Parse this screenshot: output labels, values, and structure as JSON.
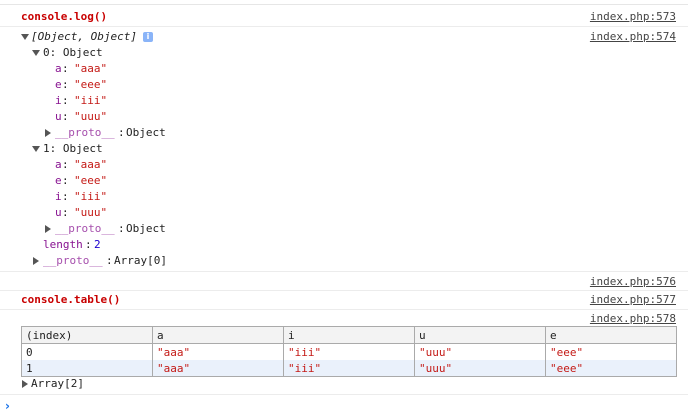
{
  "msg1": {
    "label": "console.log()",
    "source": "index.php:573"
  },
  "array_log": {
    "source": "index.php:574",
    "summary": "[Object, Object]",
    "info_badge": "i",
    "items": [
      {
        "header": "0: Object",
        "props": [
          {
            "k": "a",
            "v": "\"aaa\""
          },
          {
            "k": "e",
            "v": "\"eee\""
          },
          {
            "k": "i",
            "v": "\"iii\""
          },
          {
            "k": "u",
            "v": "\"uuu\""
          }
        ],
        "proto_key": "__proto__",
        "proto_val": "Object"
      },
      {
        "header": "1: Object",
        "props": [
          {
            "k": "a",
            "v": "\"aaa\""
          },
          {
            "k": "e",
            "v": "\"eee\""
          },
          {
            "k": "i",
            "v": "\"iii\""
          },
          {
            "k": "u",
            "v": "\"uuu\""
          }
        ],
        "proto_key": "__proto__",
        "proto_val": "Object"
      }
    ],
    "length_key": "length",
    "length_val": "2",
    "array_proto_key": "__proto__",
    "array_proto_val": "Array[0]"
  },
  "msg3": {
    "source": "index.php:576"
  },
  "msg4": {
    "label": "console.table()",
    "source": "index.php:577"
  },
  "table_msg": {
    "source": "index.php:578",
    "columns": [
      "(index)",
      "a",
      "i",
      "u",
      "e"
    ],
    "rows": [
      [
        "0",
        "\"aaa\"",
        "\"iii\"",
        "\"uuu\"",
        "\"eee\""
      ],
      [
        "1",
        "\"aaa\"",
        "\"iii\"",
        "\"uuu\"",
        "\"eee\""
      ]
    ],
    "footer": "Array[2]"
  },
  "prompt": {
    "symbol": "›"
  },
  "colors": {
    "label_red": "#c80000",
    "key_purple": "#881391",
    "string_red": "#c41a16",
    "number_blue": "#1c00cf",
    "prompt_blue": "#1a73e8"
  }
}
